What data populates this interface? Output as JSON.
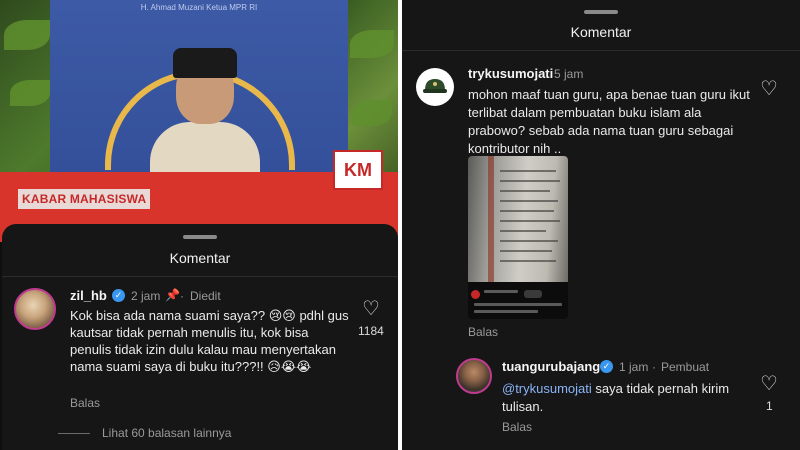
{
  "left": {
    "poster_caption": "H. Ahmad Muzani Ketua MPR RI",
    "logo_text": "KM",
    "kabar_label": "KABAR MAHASISWA",
    "sheet_title": "Komentar",
    "comment": {
      "username": "zil_hb",
      "time": "2 jam",
      "pinned_icon": "pin-icon",
      "edited": "Diedit",
      "text": "Kok bisa ada nama suami saya?? 😢😢 pdhl gus kautsar tidak pernah menulis itu, kok bisa penulis tidak izin dulu kalau mau menyertakan nama suami saya di buku itu???!! 😥😭😭",
      "reply_label": "Balas",
      "like_count": "1184",
      "view_replies": "Lihat 60 balasan lainnya"
    }
  },
  "right": {
    "sheet_title": "Komentar",
    "comment": {
      "username": "trykusumojati",
      "time": "5 jam",
      "text": "mohon maaf tuan guru, apa benae tuan guru ikut terlibat dalam pembuatan buku islam ala prabowo? sebab ada nama tuan guru sebagai kontributor nih ..",
      "reply_label": "Balas"
    },
    "reply": {
      "username": "tuangurubajang",
      "time": "1 jam",
      "creator_label": "Pembuat",
      "mention": "@trykusumojati",
      "text": " saya tidak pernah kirim tulisan.",
      "reply_label": "Balas",
      "like_count": "1"
    }
  },
  "colors": {
    "sheet_bg": "#161616",
    "verified_blue": "#3897f0",
    "mention_blue": "#8ab4f8",
    "brand_red": "#d9342b"
  }
}
